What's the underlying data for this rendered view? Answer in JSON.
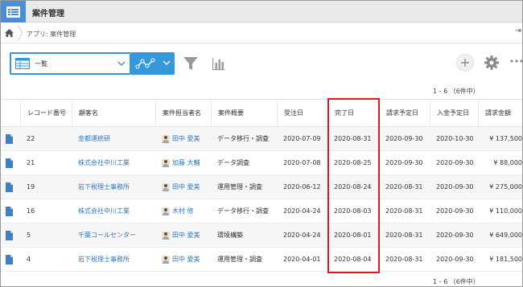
{
  "app": {
    "title": "案件管理"
  },
  "breadcrumb": {
    "text": "アプリ: 案件管理",
    "right_glyph": "⇥"
  },
  "toolbar": {
    "view_label": "一覧",
    "accent": "#3498db"
  },
  "pager": {
    "top": "1 - 6 （6件中）",
    "bottom": "1 - 6 （6件中）"
  },
  "table": {
    "columns": [
      "レコード番号",
      "顧客名",
      "案件担当者名",
      "案件概要",
      "受注日",
      "完了日",
      "請求予定日",
      "入金予定日",
      "請求金額"
    ],
    "rows": [
      {
        "id": "22",
        "customer": "金都運統研",
        "owner": "田中 愛美",
        "summary": "データ移行・調査",
        "order": "2020-07-09",
        "done": "2020-08-31",
        "bill": "2020-09-30",
        "pay": "2020-10-30",
        "amount": "¥ 137,500"
      },
      {
        "id": "21",
        "customer": "株式会社中川工業",
        "owner": "加藤 大輔",
        "summary": "データ調査",
        "order": "2020-07-08",
        "done": "2020-08-25",
        "bill": "2020-09-30",
        "pay": "2020-09-30",
        "amount": "¥ 88,000"
      },
      {
        "id": "19",
        "customer": "岩下税理士事務所",
        "owner": "田中 愛美",
        "summary": "運用管理・調査",
        "order": "2020-06-12",
        "done": "2020-08-24",
        "bill": "2020-08-31",
        "pay": "2020-09-30",
        "amount": "¥ 275,000"
      },
      {
        "id": "16",
        "customer": "株式会社中川工業",
        "owner": "木村 修",
        "summary": "データ移行・調査",
        "order": "2020-04-24",
        "done": "2020-08-03",
        "bill": "2020-08-31",
        "pay": "2020-09-30",
        "amount": "¥ 110,000"
      },
      {
        "id": "5",
        "customer": "千葉コールセンター",
        "owner": "田中 愛美",
        "summary": "環境構築",
        "order": "2020-04-24",
        "done": "2020-08-01",
        "bill": "2020-08-31",
        "pay": "2020-09-30",
        "amount": "¥ 649,000"
      },
      {
        "id": "4",
        "customer": "岩下税理士事務所",
        "owner": "田中 愛美",
        "summary": "運用管理・調査",
        "order": "2020-04-01",
        "done": "2020-08-04",
        "bill": "2020-08-31",
        "pay": "2020-09-30",
        "amount": "¥ 181,500"
      }
    ]
  },
  "colors": {
    "link": "#2e77c0",
    "highlight": "#e0191c",
    "header_bg": "#e9e9e9"
  }
}
